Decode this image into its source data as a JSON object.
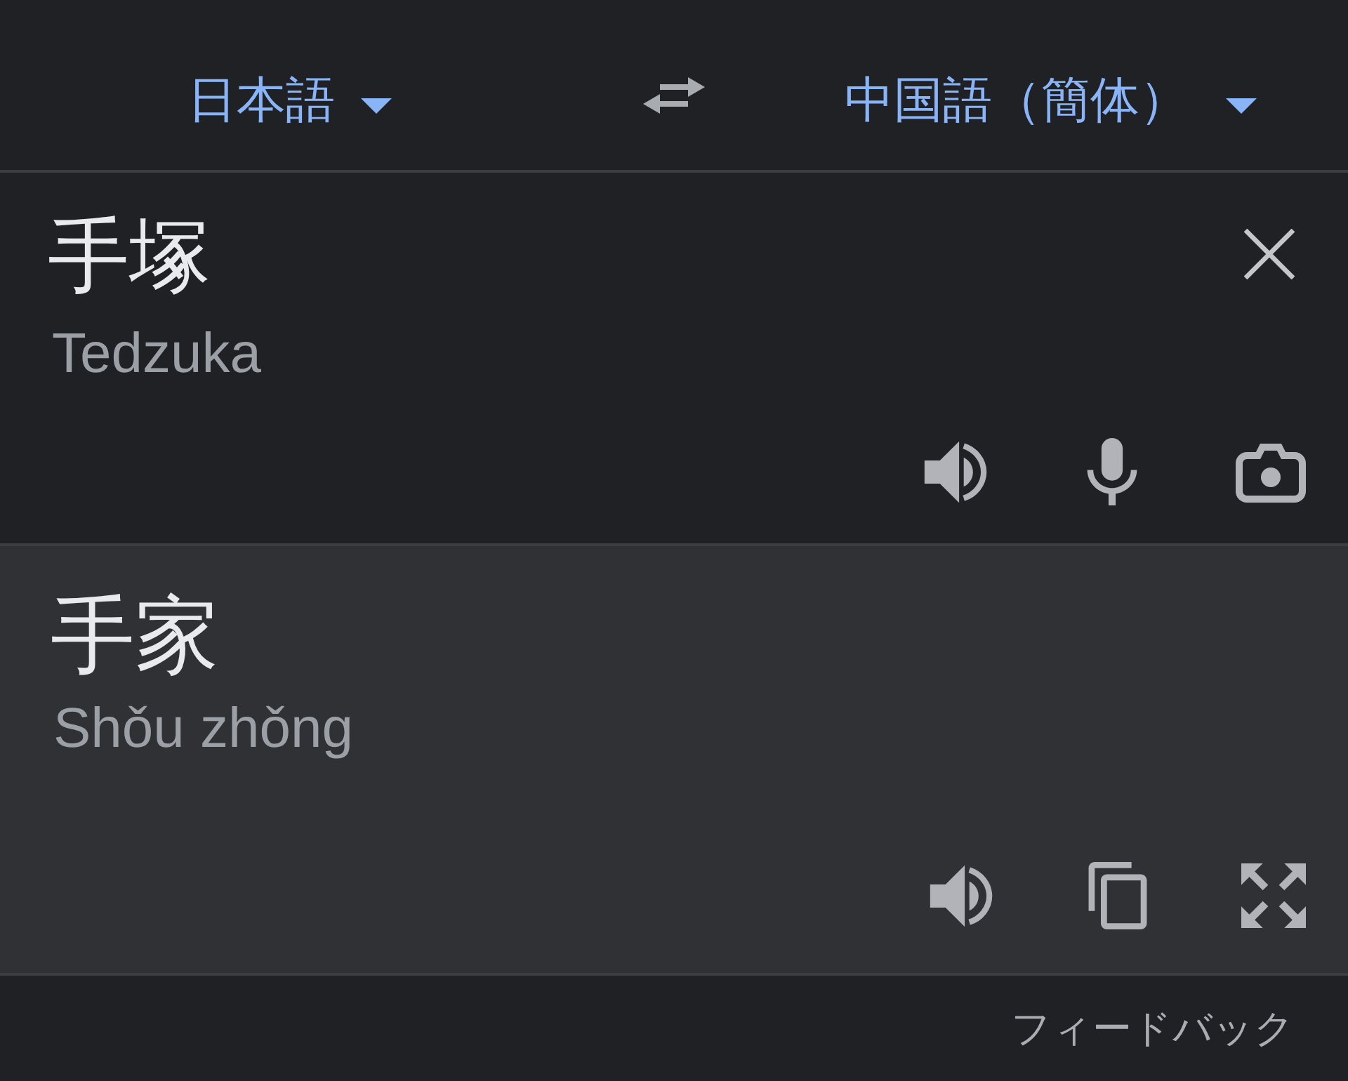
{
  "language_bar": {
    "source_language": {
      "label": "日本語"
    },
    "target_language": {
      "label": "中国語（簡体）"
    }
  },
  "input": {
    "text": "手塚",
    "romanization": "Tedzuka"
  },
  "output": {
    "text": "手家",
    "romanization": "Shǒu zhǒng"
  },
  "footer": {
    "feedback_link": "フィードバック"
  }
}
